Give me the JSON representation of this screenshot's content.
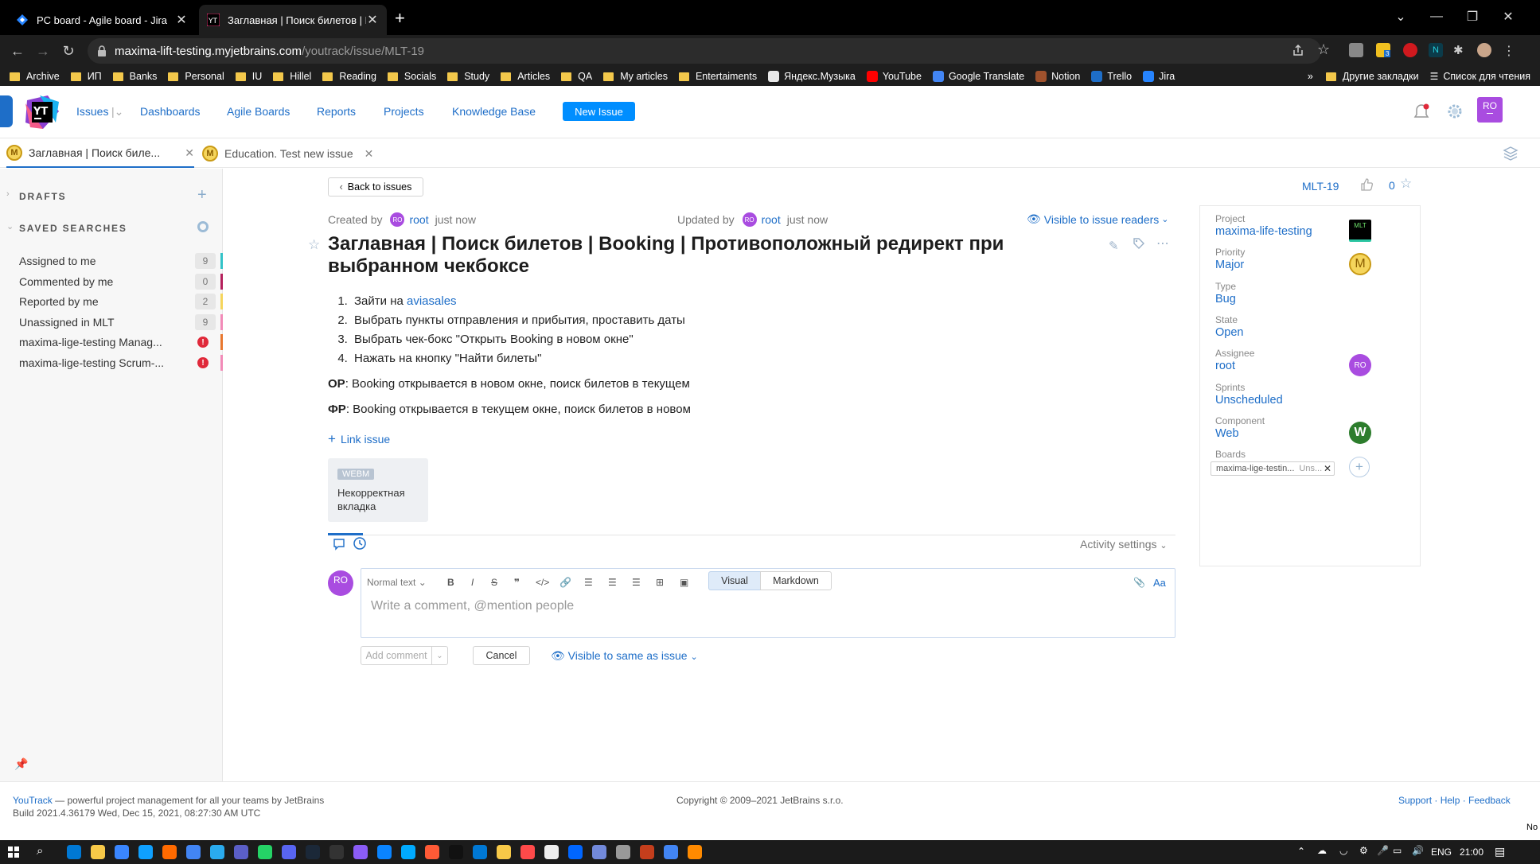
{
  "browser": {
    "tabs": [
      {
        "title": "PC board - Agile board - Jira",
        "active": false
      },
      {
        "title": "Заглавная | Поиск билетов | Boo",
        "active": true
      }
    ],
    "new_tab": "+",
    "url_host": "maxima-lift-testing.myjetbrains.com",
    "url_path": "/youtrack/issue/MLT-19",
    "ext_badge": "3",
    "bookmarks": [
      {
        "label": "Archive",
        "kind": "folder"
      },
      {
        "label": "ИП",
        "kind": "folder"
      },
      {
        "label": "Banks",
        "kind": "folder"
      },
      {
        "label": "Personal",
        "kind": "folder"
      },
      {
        "label": "IU",
        "kind": "folder"
      },
      {
        "label": "Hillel",
        "kind": "folder"
      },
      {
        "label": "Reading",
        "kind": "folder"
      },
      {
        "label": "Socials",
        "kind": "folder"
      },
      {
        "label": "Study",
        "kind": "folder"
      },
      {
        "label": "Articles",
        "kind": "folder"
      },
      {
        "label": "QA",
        "kind": "folder"
      },
      {
        "label": "My articles",
        "kind": "folder"
      },
      {
        "label": "Entertaiments",
        "kind": "folder"
      },
      {
        "label": "Яндекс.Музыка",
        "kind": "site"
      },
      {
        "label": "YouTube",
        "kind": "site"
      },
      {
        "label": "Google Translate",
        "kind": "site"
      },
      {
        "label": "Notion",
        "kind": "site"
      },
      {
        "label": "Trello",
        "kind": "site"
      },
      {
        "label": "Jira",
        "kind": "site"
      }
    ],
    "bookmarks_more": "»",
    "other_bookmarks": "Другие закладки",
    "reading_list": "Список для чтения"
  },
  "header": {
    "logo": "YT",
    "nav": [
      "Issues",
      "Dashboards",
      "Agile Boards",
      "Reports",
      "Projects",
      "Knowledge Base"
    ],
    "new_issue": "New Issue",
    "user_initials": "RO"
  },
  "open_tabs": [
    {
      "icon": "M",
      "title": "Заглавная | Поиск биле..."
    },
    {
      "icon": "M",
      "title": "Education. Test new issue"
    }
  ],
  "sidebar": {
    "drafts": "DRAFTS",
    "saved_searches": "SAVED SEARCHES",
    "items": [
      {
        "label": "Assigned to me",
        "count": "9",
        "color": "#33c3c8"
      },
      {
        "label": "Commented by me",
        "count": "0",
        "color": "#b5215c"
      },
      {
        "label": "Reported by me",
        "count": "2",
        "color": "#f5d55c"
      },
      {
        "label": "Unassigned in MLT",
        "count": "9",
        "color": "#f28bb8"
      },
      {
        "label": "maxima-lige-testing Manag...",
        "count": "!",
        "color": "#e8782f"
      },
      {
        "label": "maxima-lige-testing Scrum-...",
        "count": "!",
        "color": "#f28bb8"
      }
    ]
  },
  "issue": {
    "back": "Back to issues",
    "id": "MLT-19",
    "votes": "0",
    "created_label": "Created by",
    "created_user": "root",
    "created_time": "just now",
    "updated_label": "Updated by",
    "updated_user": "root",
    "updated_time": "just now",
    "visibility": "Visible to issue readers",
    "title": "Заглавная | Поиск билетов | Booking | Противоположный редирект при выбранном чекбоксе",
    "steps": [
      {
        "text": "Зайти на ",
        "link": "aviasales"
      },
      {
        "text": "Выбрать пункты отправления и прибытия, проставить даты",
        "link": ""
      },
      {
        "text": "Выбрать чек-бокс \"Открыть Booking в новом окне\"",
        "link": ""
      },
      {
        "text": "Нажать на кнопку \"Найти билеты\"",
        "link": ""
      }
    ],
    "op_label": "ОР",
    "op_text": ": Booking открывается в новом окне, поиск билетов в текущем",
    "fr_label": "ФР",
    "fr_text": ": Booking открывается в текущем окне, поиск билетов в новом",
    "link_issue": "Link issue",
    "attachment": {
      "badge": "WEBM",
      "name": "Некорректная вкладка"
    }
  },
  "activity": {
    "settings": "Activity settings",
    "avatar": "RO",
    "format": "Normal text",
    "mode_visual": "Visual",
    "mode_markdown": "Markdown",
    "font_toggle": "Aa",
    "placeholder": "Write a comment, @mention people",
    "add_comment": "Add comment",
    "cancel": "Cancel",
    "visibility": "Visible to same as issue"
  },
  "fields": [
    {
      "label": "Project",
      "value": "maxima-life-testing",
      "badge": "MLT"
    },
    {
      "label": "Priority",
      "value": "Major",
      "badge": "M"
    },
    {
      "label": "Type",
      "value": "Bug",
      "badge": ""
    },
    {
      "label": "State",
      "value": "Open",
      "badge": ""
    },
    {
      "label": "Assignee",
      "value": "root",
      "badge": "RO"
    },
    {
      "label": "Sprints",
      "value": "Unscheduled",
      "badge": ""
    },
    {
      "label": "Component",
      "value": "Web",
      "badge": "W"
    },
    {
      "label": "Boards",
      "value": "maxima-lige-testin...",
      "badge": "Uns..."
    }
  ],
  "footer": {
    "product": "YouTrack",
    "tagline": " — powerful project management for all your teams by JetBrains",
    "build": "Build 2021.4.36179 Wed, Dec 15, 2021, 08:27:30 AM UTC",
    "copyright": "Copyright © 2009–2021 JetBrains s.r.o.",
    "links": "Support · Help · Feedback"
  },
  "taskbar": {
    "lang": "ENG",
    "time": "21:00",
    "edge_text": "No"
  },
  "colors": {
    "accent": "#008eff",
    "link": "#1e6ec8",
    "avatar": "#a94ce0"
  }
}
